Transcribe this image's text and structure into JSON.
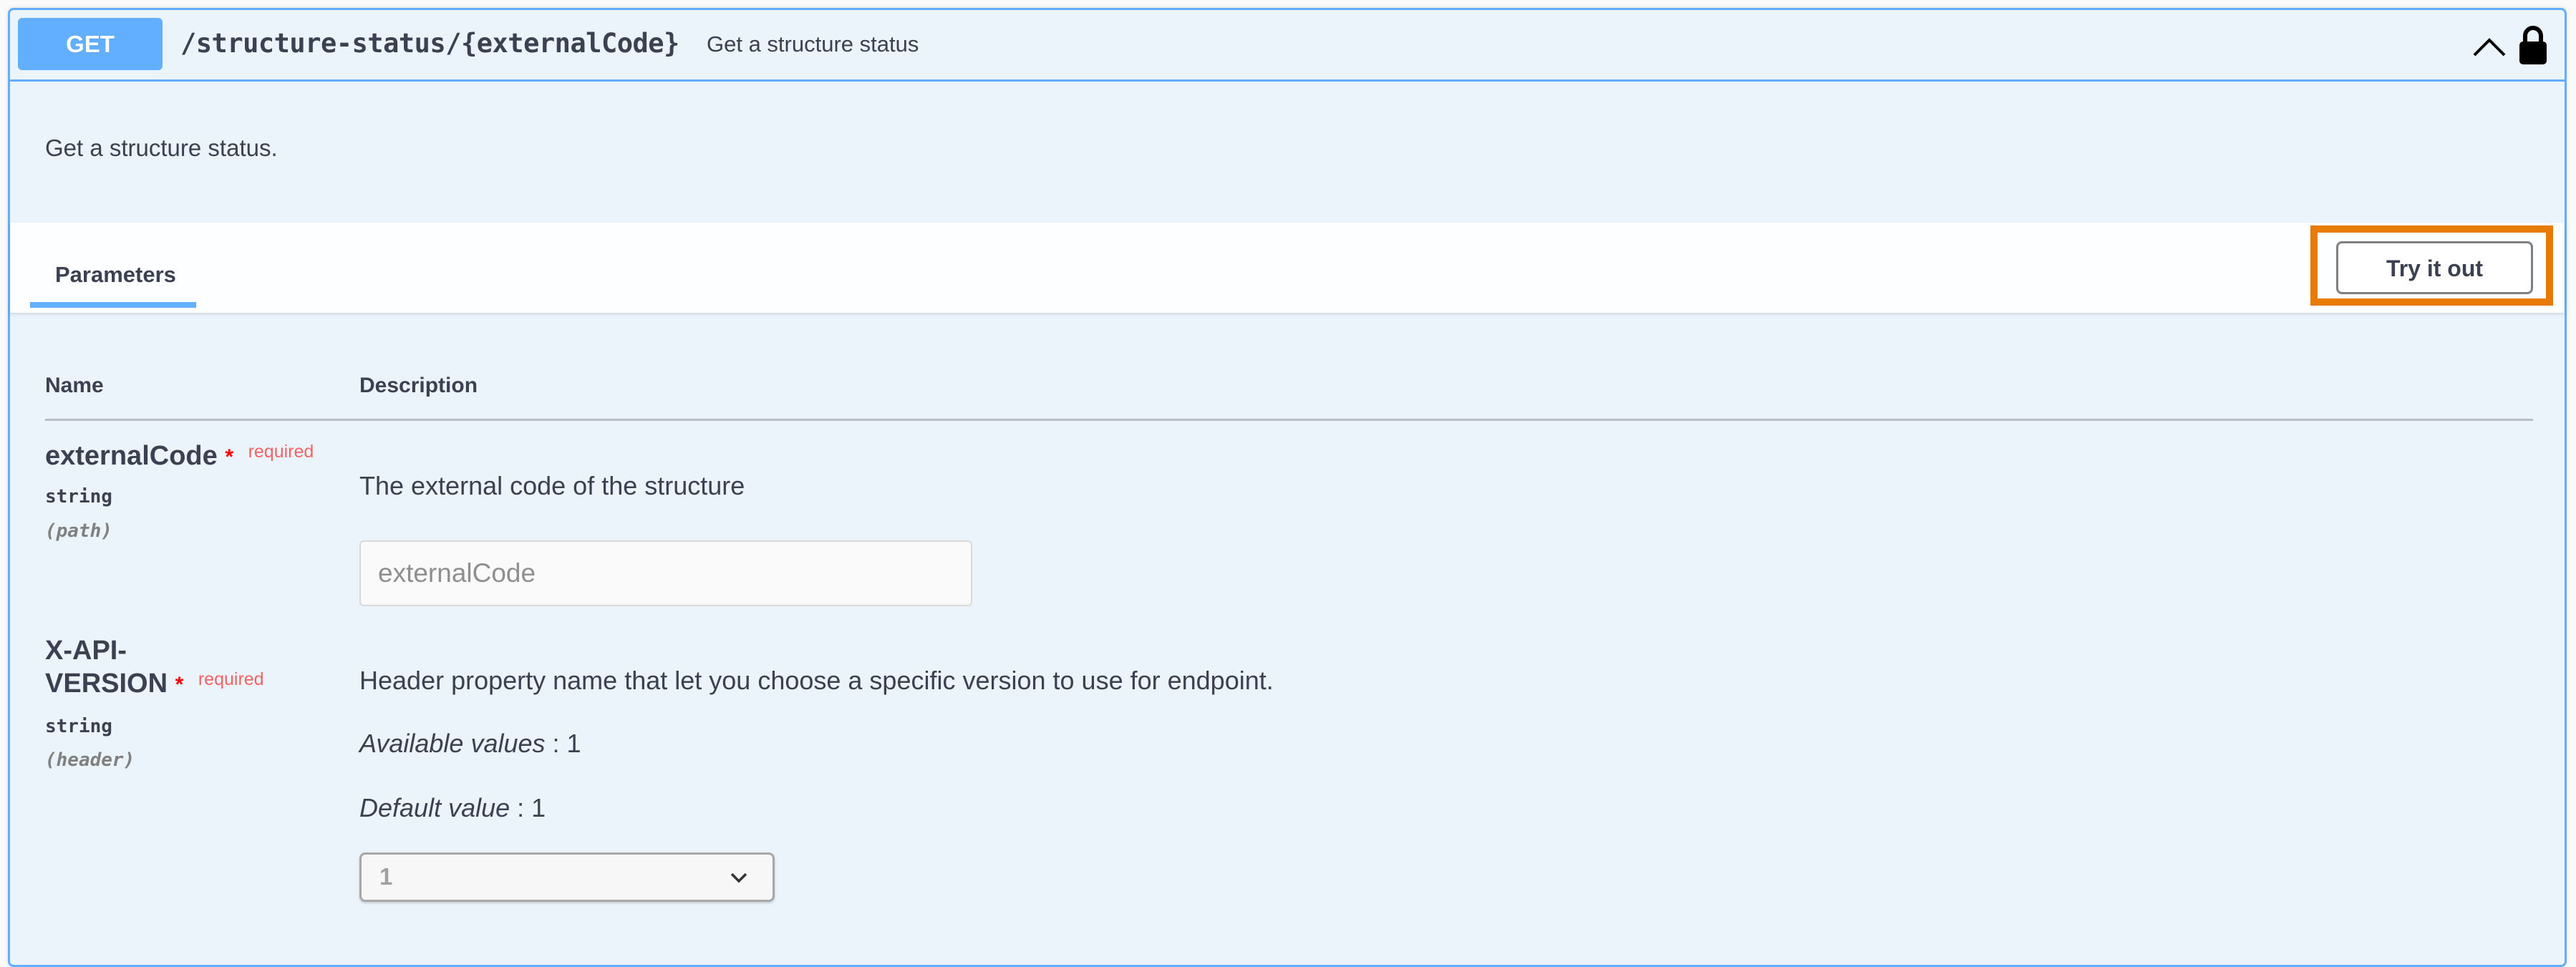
{
  "operation": {
    "method": "GET",
    "path": "/structure-status/{externalCode}",
    "summary": "Get a structure status",
    "description": "Get a structure status.",
    "icons": {
      "collapse": "chevron-up-icon",
      "auth": "lock-icon"
    }
  },
  "tabs": [
    {
      "label": "Parameters",
      "active": true
    }
  ],
  "try_it_out_label": "Try it out",
  "table": {
    "headers": {
      "name": "Name",
      "description": "Description"
    },
    "parameters": [
      {
        "name": "externalCode",
        "required_star": "*",
        "required_label": "required",
        "type": "string",
        "in": "(path)",
        "description": "The external code of the structure",
        "input_placeholder": "externalCode"
      },
      {
        "name_line1": "X-API-",
        "name_line2": "VERSION",
        "required_star": "*",
        "required_label": "required",
        "type": "string",
        "in": "(header)",
        "description": "Header property name that let you choose a specific version to use for endpoint.",
        "available_values_label": "Available values",
        "available_values": ": 1",
        "default_value_label": "Default value",
        "default_value": ": 1",
        "select_value": "1"
      }
    ]
  },
  "colors": {
    "get_accent": "#61affe",
    "highlight": "#e87b07",
    "required": "#f93e3e"
  }
}
